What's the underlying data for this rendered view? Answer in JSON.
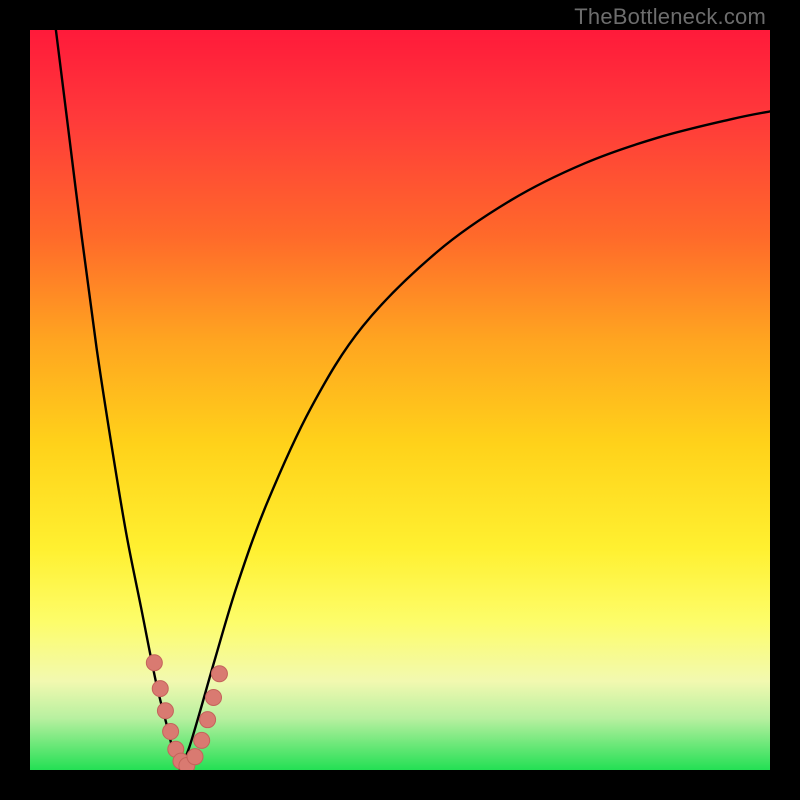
{
  "watermark": "TheBottleneck.com",
  "colors": {
    "frame": "#000000",
    "curve": "#000000",
    "marker_fill": "#d97a71",
    "marker_stroke": "#c4635b"
  },
  "chart_data": {
    "type": "line",
    "title": "",
    "xlabel": "",
    "ylabel": "",
    "xlim": [
      0,
      100
    ],
    "ylim": [
      0,
      100
    ],
    "note": "Axes are unlabeled; values are x-percentage across the plot and y-percentage (0=bottom, 100=top) estimated from pixel positions.",
    "series": [
      {
        "name": "left-branch",
        "x": [
          3.5,
          5,
          7,
          9,
          11,
          13,
          15,
          17,
          18.5,
          19.5,
          20.3
        ],
        "y": [
          100,
          88,
          72,
          57,
          44,
          32,
          22,
          12,
          6,
          2,
          0
        ]
      },
      {
        "name": "right-branch",
        "x": [
          20.3,
          21.5,
          23,
          25,
          28,
          32,
          38,
          45,
          55,
          65,
          75,
          85,
          95,
          100
        ],
        "y": [
          0,
          3,
          8,
          15,
          25,
          36,
          49,
          60,
          70,
          77,
          82,
          85.5,
          88,
          89
        ]
      }
    ],
    "markers": {
      "name": "data-points",
      "x": [
        16.8,
        17.6,
        18.3,
        19.0,
        19.7,
        20.4,
        21.2,
        22.3,
        23.2,
        24.0,
        24.8,
        25.6
      ],
      "y": [
        14.5,
        11.0,
        8.0,
        5.2,
        2.8,
        1.2,
        0.6,
        1.8,
        4.0,
        6.8,
        9.8,
        13.0
      ],
      "radius_px": 8
    }
  }
}
